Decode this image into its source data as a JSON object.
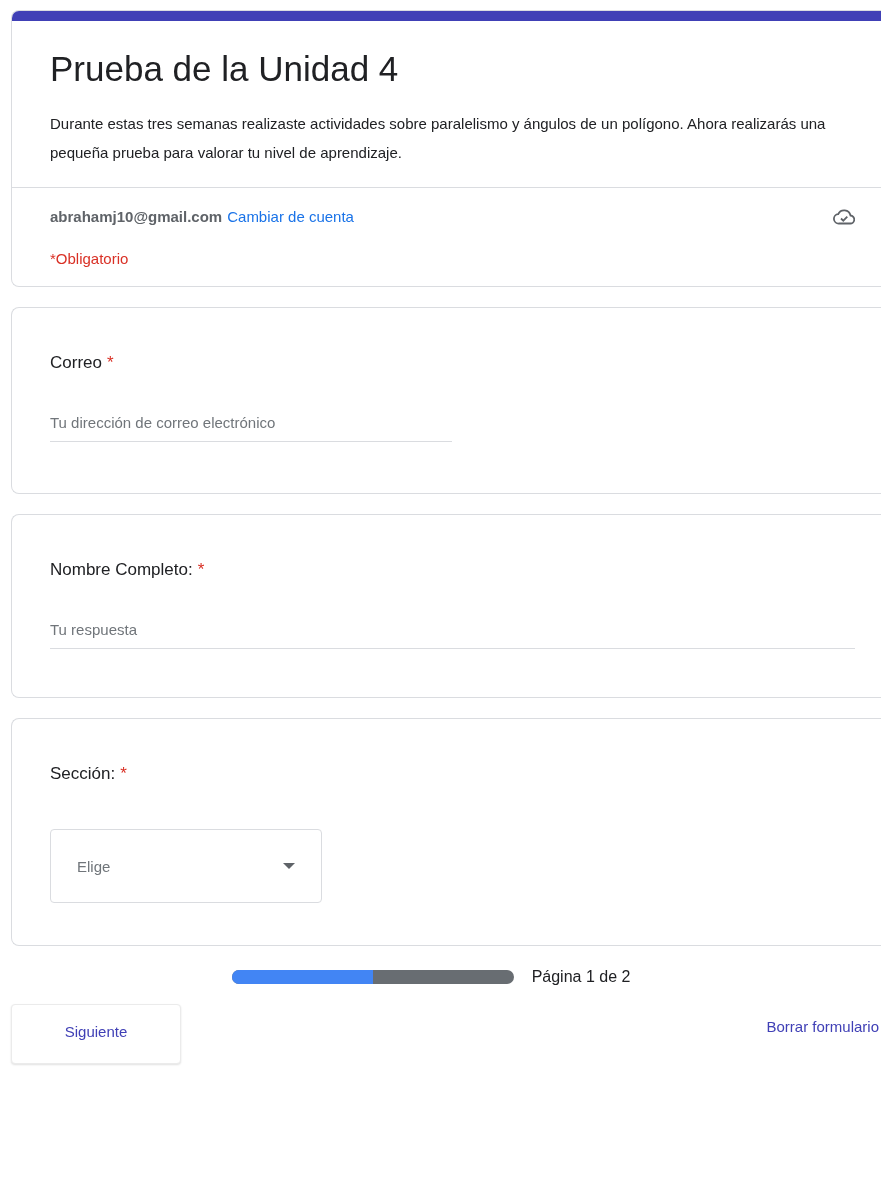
{
  "header": {
    "title": "Prueba de la Unidad 4",
    "description": "Durante estas tres semanas realizaste actividades sobre paralelismo y ángulos de un polígono. Ahora realizarás una pequeña prueba para valorar tu nivel de aprendizaje.",
    "account": "abrahamj10@gmail.com",
    "switch_account": "Cambiar de cuenta",
    "required_note": "*Obligatorio"
  },
  "questions": [
    {
      "kind": "email",
      "label": "Correo",
      "required": true,
      "required_mark": "*",
      "placeholder": "Tu dirección de correo electrónico"
    },
    {
      "kind": "text",
      "label": "Nombre Completo:",
      "required": true,
      "required_mark": "*",
      "placeholder": "Tu respuesta"
    },
    {
      "kind": "dropdown",
      "label": "Sección:",
      "required": true,
      "required_mark": "*",
      "placeholder": "Elige"
    }
  ],
  "progress": {
    "level": 0.5,
    "label": "Página 1 de 2"
  },
  "buttons": {
    "next": "Siguiente",
    "clear": "Borrar formulario"
  }
}
